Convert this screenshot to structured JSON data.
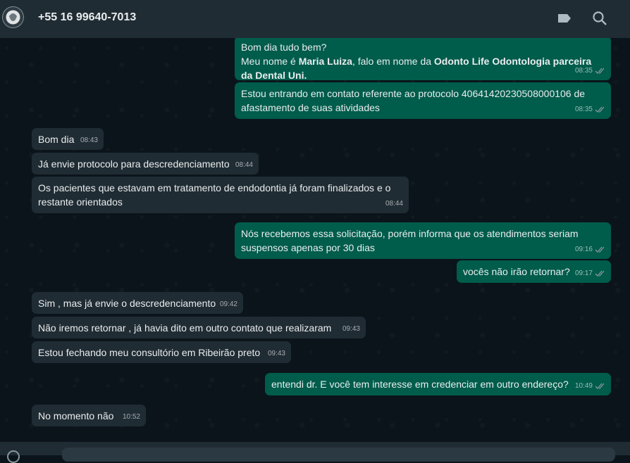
{
  "header": {
    "contact_name": "+55 16 99640-7013",
    "icons": [
      "avatar",
      "label-icon",
      "search-icon"
    ]
  },
  "messages": [
    {
      "dir": "out",
      "line1": "Bom dia tudo bem?",
      "line2_pre": "Meu nome é ",
      "line2_b1": "Maria Luiza",
      "line2_mid": ", falo em nome da ",
      "line2_b2": "Odonto Life Odontologia parceira",
      "line3_b": "da Dental Uni.",
      "time": "08:35"
    },
    {
      "dir": "out",
      "text1": "Estou entrando em contato referente ao protocolo 40641420230508000106 de",
      "text2": "afastamento de suas atividades",
      "time": "08:35"
    },
    {
      "dir": "in",
      "text": "Bom dia",
      "time": "08:43"
    },
    {
      "dir": "in",
      "text": "Já envie protocolo para descredenciamento",
      "time": "08:44"
    },
    {
      "dir": "in",
      "text1": "Os pacientes que estavam em tratamento de endodontia já foram finalizados e o",
      "text2": "restante orientados",
      "time": "08:44"
    },
    {
      "dir": "out",
      "text1": "Nós recebemos essa solicitação, porém informa que os atendimentos seriam",
      "text2": "suspensos apenas por 30 dias",
      "time": "09:16"
    },
    {
      "dir": "out",
      "text": "vocês não irão retornar?",
      "time": "09:17"
    },
    {
      "dir": "in",
      "text": "Sim , mas já envie o descredenciamento",
      "time": "09:42"
    },
    {
      "dir": "in",
      "text": "Não iremos retornar , já havia dito em outro contato que realizaram",
      "time": "09:43"
    },
    {
      "dir": "in",
      "text": "Estou fechando meu consultório em Ribeirão preto",
      "time": "09:43"
    },
    {
      "dir": "out",
      "text": "entendi dr. E você tem interesse em credenciar em outro endereço?",
      "time": "10:49"
    },
    {
      "dir": "in",
      "text": "No momento não",
      "time": "10:52"
    }
  ],
  "colors": {
    "outgoing_bubble": "#005c4b",
    "incoming_bubble": "#202c33",
    "header": "#202c33",
    "background": "#0b141a",
    "read_tick": "#8696a0"
  }
}
